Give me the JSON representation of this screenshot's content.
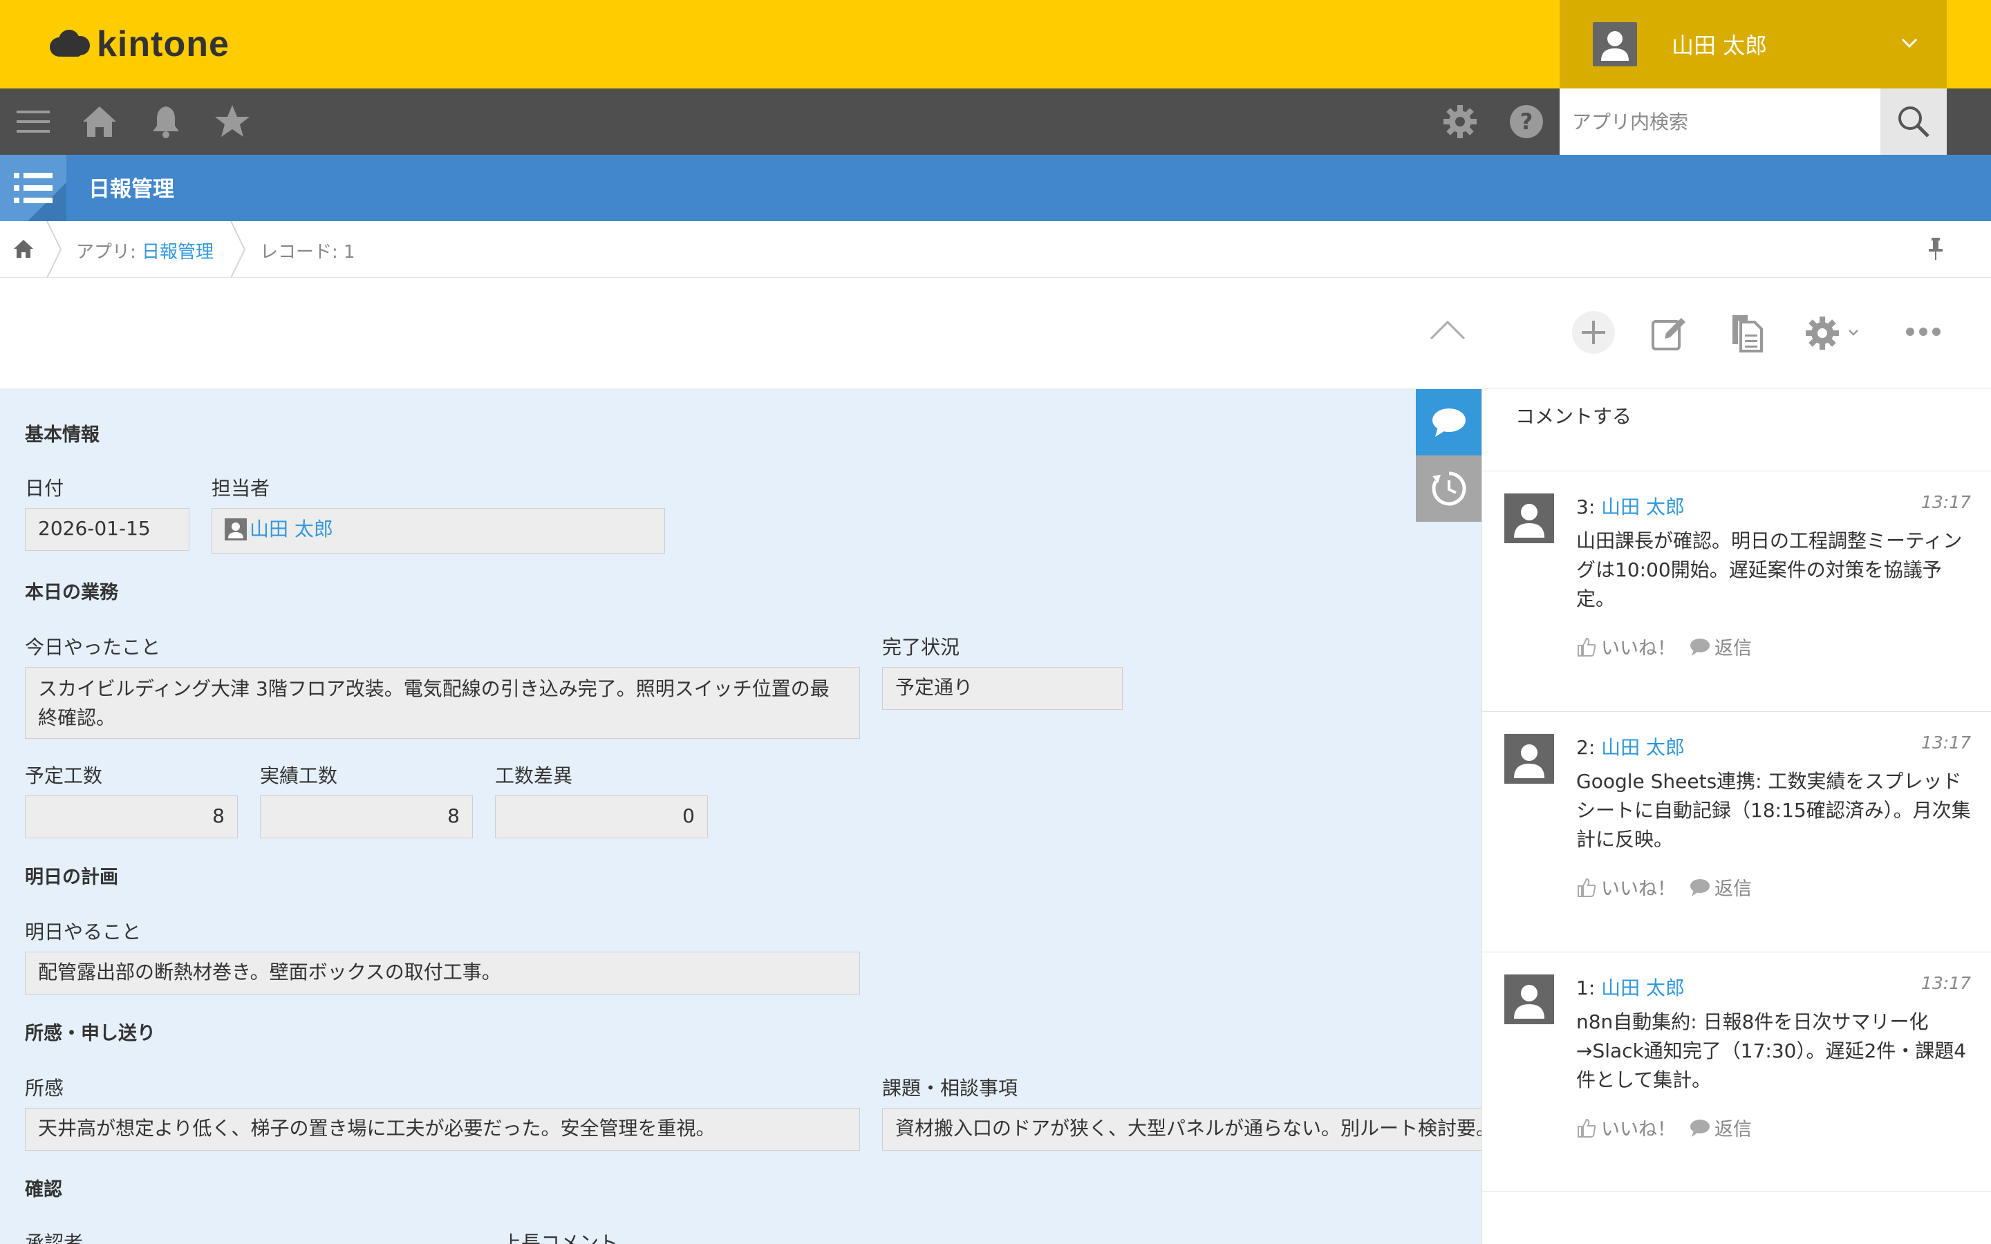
{
  "header": {
    "logo_text": "kintone",
    "user_name": "山田 太郎"
  },
  "gnav": {
    "search_placeholder": "アプリ内検索"
  },
  "app": {
    "title": "日報管理"
  },
  "breadcrumb": {
    "app_prefix": "アプリ: ",
    "app_name": "日報管理",
    "record": "レコード: 1"
  },
  "record": {
    "sections": {
      "basic": "基本情報",
      "today": "本日の業務",
      "tomorrow": "明日の計画",
      "notes": "所感・申し送り",
      "confirm": "確認"
    },
    "fields": {
      "date": {
        "label": "日付",
        "value": "2026-01-15"
      },
      "assignee": {
        "label": "担当者",
        "value": "山田 太郎"
      },
      "done_today": {
        "label": "今日やったこと",
        "value": "スカイビルディング大津 3階フロア改装。電気配線の引き込み完了。照明スイッチ位置の最終確認。"
      },
      "status": {
        "label": "完了状況",
        "value": "予定通り"
      },
      "planned_hours": {
        "label": "予定工数",
        "value": "8"
      },
      "actual_hours": {
        "label": "実績工数",
        "value": "8"
      },
      "diff_hours": {
        "label": "工数差異",
        "value": "0"
      },
      "tomorrow_tasks": {
        "label": "明日やること",
        "value": "配管露出部の断熱材巻き。壁面ボックスの取付工事。"
      },
      "impressions": {
        "label": "所感",
        "value": "天井高が想定より低く、梯子の置き場に工夫が必要だった。安全管理を重視。"
      },
      "issues": {
        "label": "課題・相談事項",
        "value": "資材搬入口のドアが狭く、大型パネルが通らない。別ルート検討要。"
      },
      "approver": {
        "label": "承認者"
      },
      "boss_comment": {
        "label": "上長コメント"
      }
    }
  },
  "comments": {
    "prompt": "コメントする",
    "like_label": "いいね！",
    "reply_label": "返信",
    "items": [
      {
        "num": "3:",
        "user": "山田 太郎",
        "time": "13:17",
        "text": "山田課長が確認。明日の工程調整ミーティングは10:00開始。遅延案件の対策を協議予定。"
      },
      {
        "num": "2:",
        "user": "山田 太郎",
        "time": "13:17",
        "text": "Google Sheets連携: 工数実績をスプレッドシートに自動記録（18:15確認済み）。月次集計に反映。"
      },
      {
        "num": "1:",
        "user": "山田 太郎",
        "time": "13:17",
        "text": "n8n自動集約: 日報8件を日次サマリー化→Slack通知完了（17:30）。遅延2件・課題4件として集計。"
      }
    ]
  },
  "colors": {
    "header_yellow": "#ffcc00",
    "user_menu": "#d9ac00",
    "gnav": "#4f4f4f",
    "app_bar": "#4287cb",
    "link": "#3498db",
    "record_bg": "#e6f0fa"
  }
}
